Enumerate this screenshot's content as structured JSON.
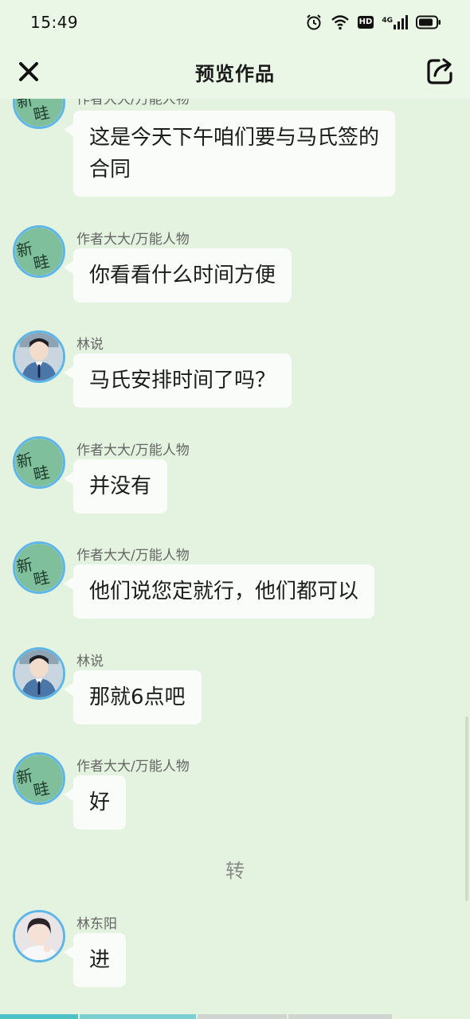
{
  "status_bar": {
    "time": "15:49",
    "network_label": "4G",
    "hd_label": "HD",
    "icons": [
      "alarm-icon",
      "wifi-icon",
      "hd-icon",
      "signal-icon",
      "battery-icon"
    ]
  },
  "header": {
    "title": "预览作品",
    "close_icon": "close-icon",
    "share_icon": "share-icon"
  },
  "colors": {
    "background": "#e4f3df",
    "bubble": "#f9fcf8",
    "avatar_ring": "#5eb6e8",
    "progress_active": "#4dc1c6"
  },
  "messages": [
    {
      "sender": "作者大大/万能人物",
      "text": "这是今天下午咱们要与马氏签的合同",
      "avatar": "xinren-avatar"
    },
    {
      "sender": "作者大大/万能人物",
      "text": "你看看什么时间方便",
      "avatar": "xinren-avatar"
    },
    {
      "sender": "林说",
      "text": "马氏安排时间了吗？",
      "avatar": "student-avatar"
    },
    {
      "sender": "作者大大/万能人物",
      "text": "并没有",
      "avatar": "xinren-avatar"
    },
    {
      "sender": "作者大大/万能人物",
      "text": "他们说您定就行，他们都可以",
      "avatar": "xinren-avatar"
    },
    {
      "sender": "林说",
      "text": "那就6点吧",
      "avatar": "student-avatar"
    },
    {
      "sender": "作者大大/万能人物",
      "text": "好",
      "avatar": "xinren-avatar"
    },
    {
      "narration": "转"
    },
    {
      "sender": "林东阳",
      "text": "进",
      "avatar": "boy-avatar"
    }
  ]
}
